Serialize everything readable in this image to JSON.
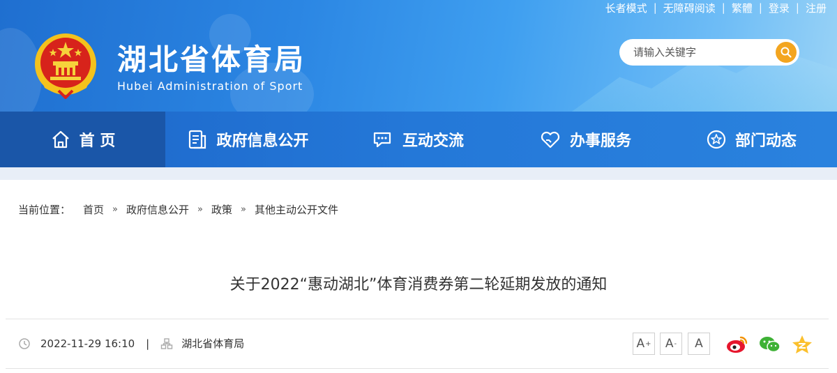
{
  "top_links": [
    "长者模式",
    "无障碍阅读",
    "繁體",
    "登录",
    "注册"
  ],
  "site": {
    "title": "湖北省体育局",
    "subtitle": "Hubei Administration of Sport"
  },
  "search": {
    "placeholder": "请输入关键字"
  },
  "nav": [
    {
      "label": "首 页",
      "icon": "home-icon"
    },
    {
      "label": "政府信息公开",
      "icon": "document-list-icon"
    },
    {
      "label": "互动交流",
      "icon": "chat-bubble-icon"
    },
    {
      "label": "办事服务",
      "icon": "heart-hand-icon"
    },
    {
      "label": "部门动态",
      "icon": "star-circle-icon"
    }
  ],
  "breadcrumb": {
    "label": "当前位置：",
    "items": [
      "首页",
      "政府信息公开",
      "政策",
      "其他主动公开文件"
    ],
    "separator": "»"
  },
  "article": {
    "title": "关于2022“惠动湖北”体育消费券第二轮延期发放的通知",
    "datetime": "2022-11-29 16:10",
    "source": "湖北省体育局"
  },
  "font_controls": [
    {
      "label": "A",
      "mark": "+"
    },
    {
      "label": "A",
      "mark": "-"
    },
    {
      "label": "A",
      "mark": ""
    }
  ],
  "share": [
    "weibo-icon",
    "wechat-icon",
    "qzone-icon"
  ],
  "colors": {
    "header_blue": "#2b86e3",
    "nav_blue": "#2478d8",
    "nav_active": "#1a56a8",
    "search_button": "#f3a51f"
  }
}
